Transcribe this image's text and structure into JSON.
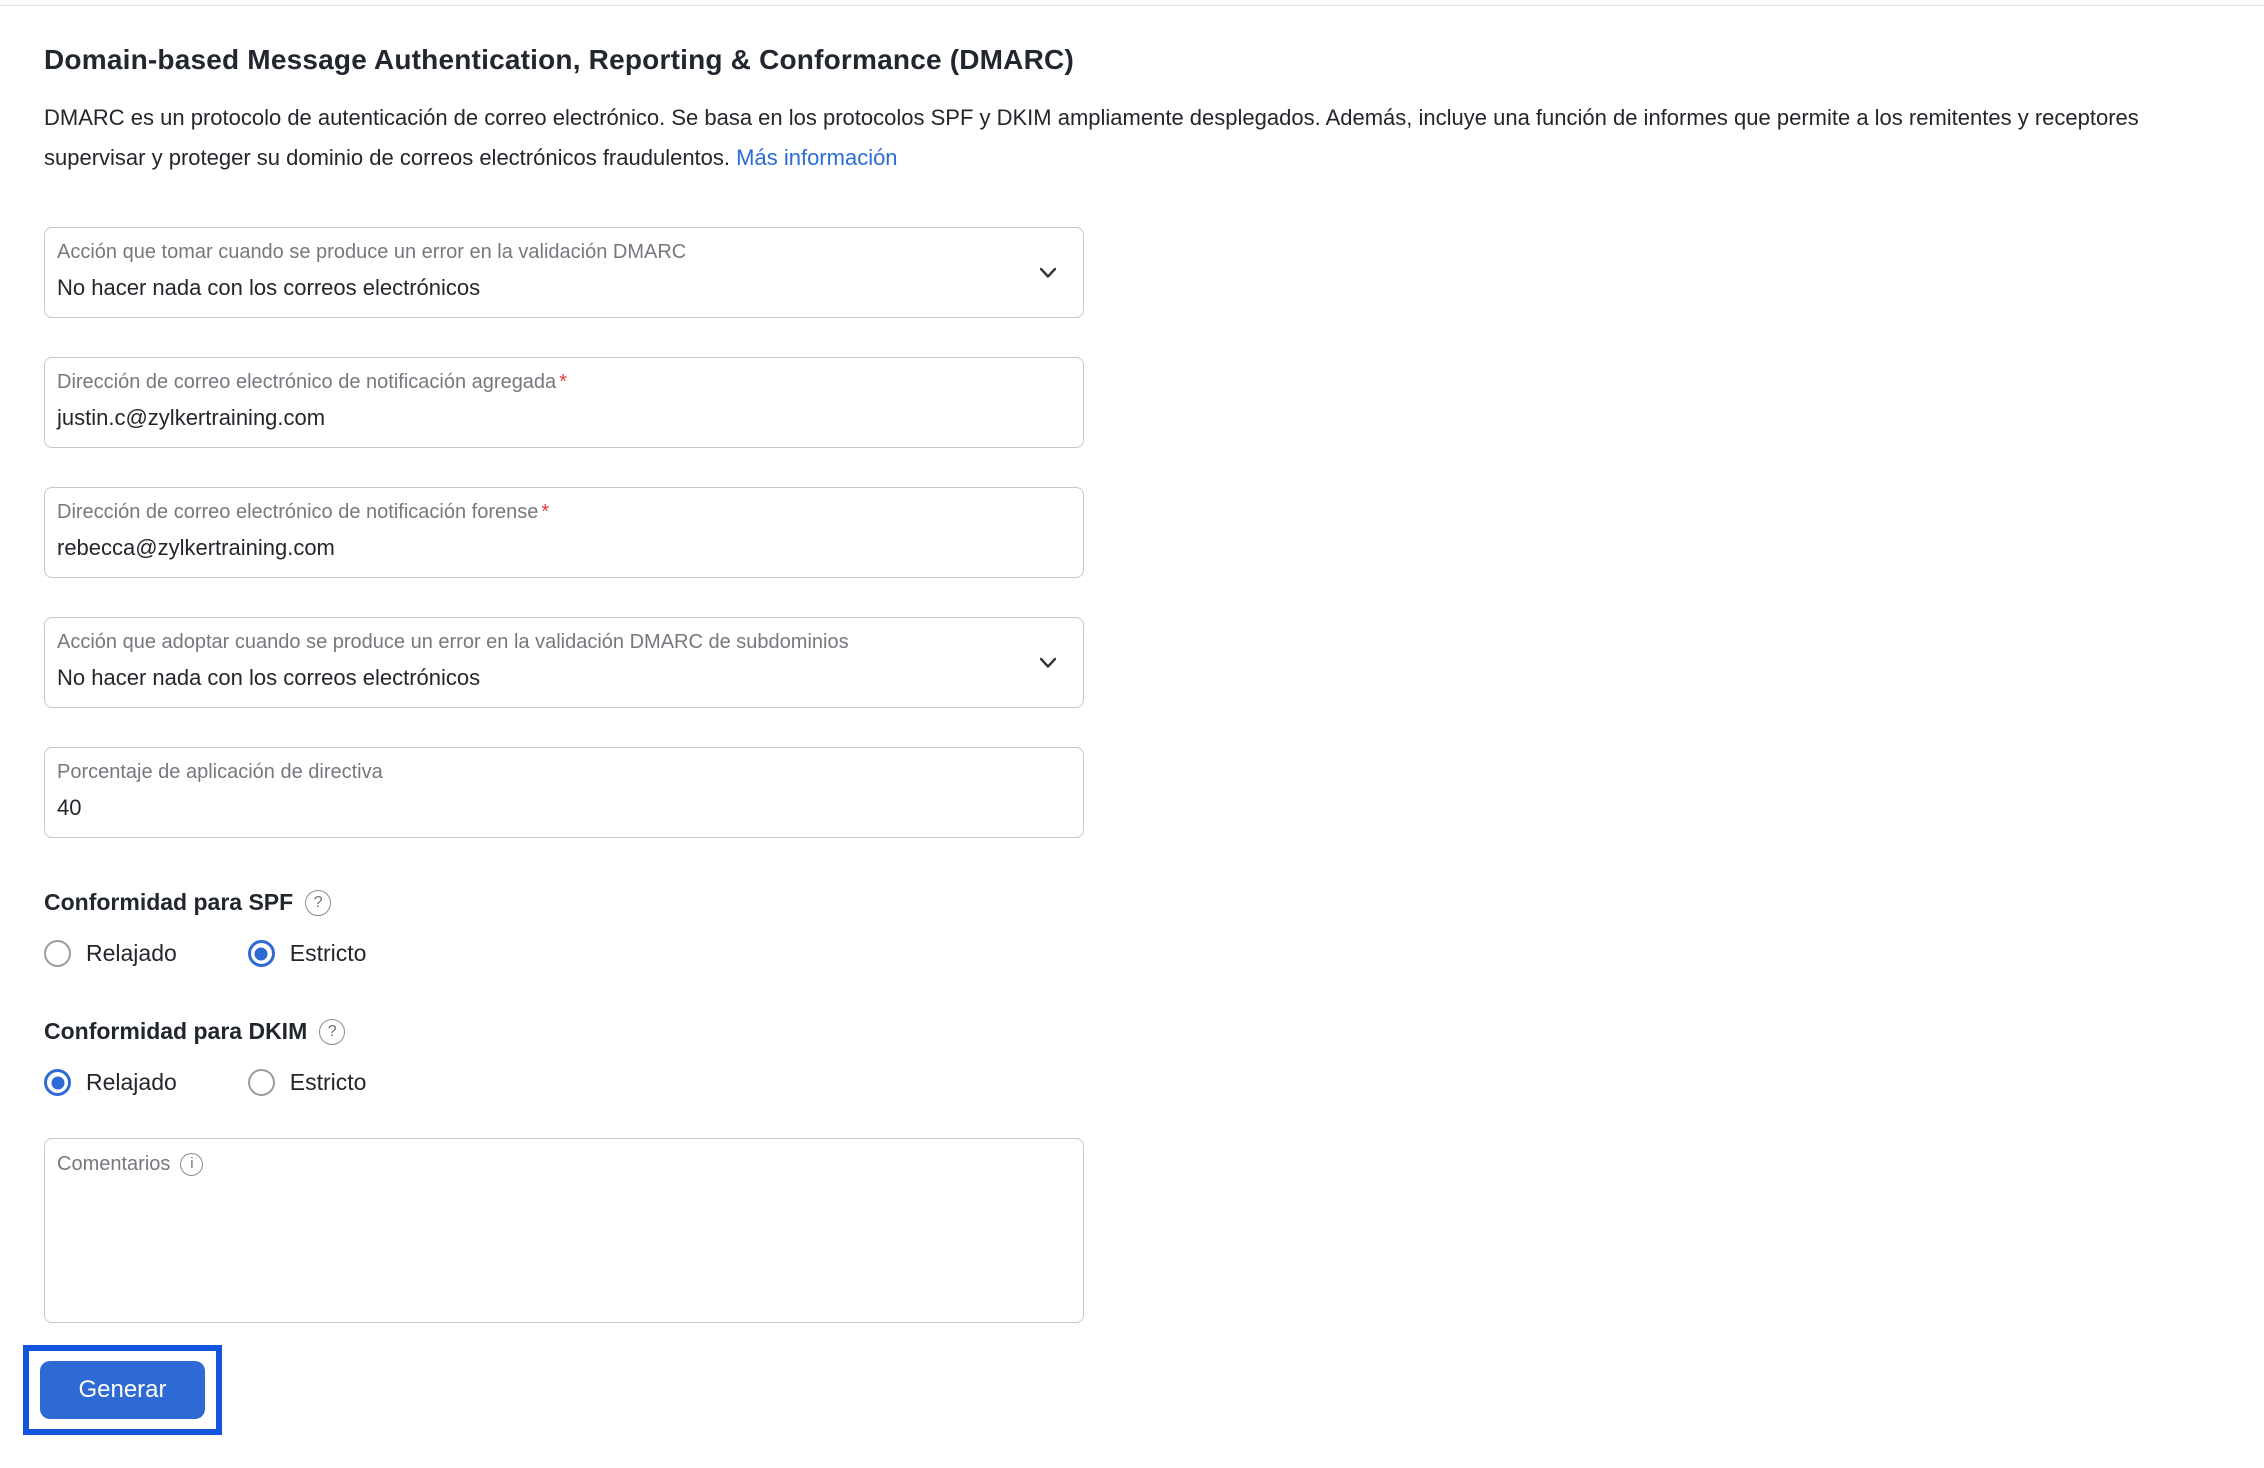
{
  "page": {
    "title": "Domain-based Message Authentication, Reporting & Conformance (DMARC)",
    "description": "DMARC es un protocolo de autenticación de correo electrónico. Se basa en los protocolos SPF y DKIM ampliamente desplegados. Además, incluye una función de informes que permite a los remitentes y receptores supervisar y proteger su dominio de correos electrónicos fraudulentos.",
    "learn_more_label": "Más información"
  },
  "fields": {
    "dmarc_action": {
      "type": "select",
      "label": "Acción que tomar cuando se produce un error en la validación DMARC",
      "value": "No hacer nada con los correos electrónicos"
    },
    "aggregate_email": {
      "type": "text",
      "label": "Dirección de correo electrónico de notificación agregada",
      "required_marker": "*",
      "value": "justin.c@zylkertraining.com"
    },
    "forensic_email": {
      "type": "text",
      "label": "Dirección de correo electrónico de notificación forense",
      "required_marker": "*",
      "value": "rebecca@zylkertraining.com"
    },
    "subdomain_action": {
      "type": "select",
      "label": "Acción que adoptar cuando se produce un error en la validación DMARC de subdominios",
      "value": "No hacer nada con los correos electrónicos"
    },
    "policy_percentage": {
      "type": "text",
      "label": "Porcentaje de aplicación de directiva",
      "value": "40"
    },
    "comments": {
      "type": "textarea",
      "label": "Comentarios",
      "value": ""
    }
  },
  "radio_groups": {
    "spf": {
      "label": "Conformidad para SPF",
      "options": [
        {
          "label": "Relajado",
          "selected": false
        },
        {
          "label": "Estricto",
          "selected": true
        }
      ]
    },
    "dkim": {
      "label": "Conformidad para DKIM",
      "options": [
        {
          "label": "Relajado",
          "selected": true
        },
        {
          "label": "Estricto",
          "selected": false
        }
      ]
    }
  },
  "icons": {
    "help_glyph": "?",
    "info_glyph": "i"
  },
  "actions": {
    "generate_label": "Generar"
  },
  "colors": {
    "accent_blue": "#2e6ad3",
    "highlight_outline_blue": "#1254dd",
    "link_blue": "#2b6cd9",
    "required_red": "#e23b3b",
    "border_gray": "#c6c8ca",
    "label_gray": "#75787d"
  }
}
